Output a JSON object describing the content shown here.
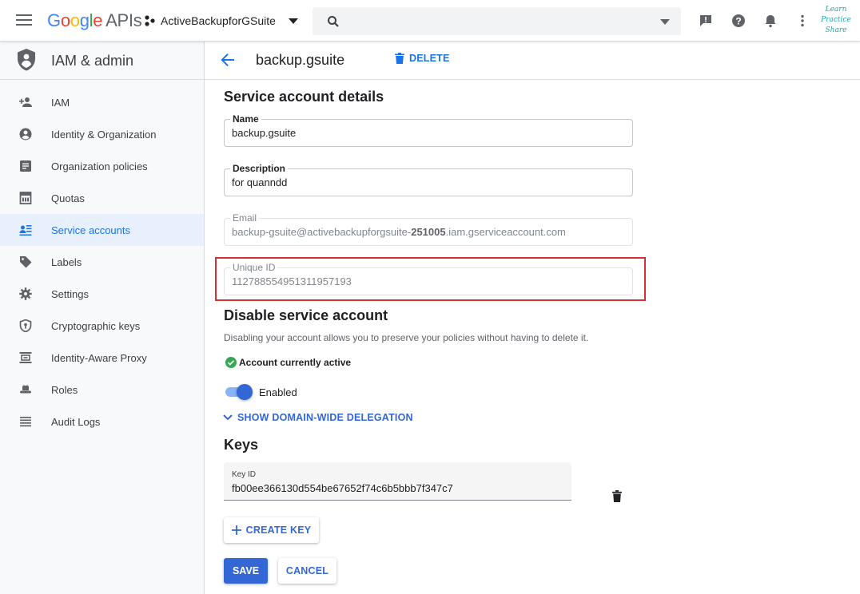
{
  "topbar": {
    "logo_parts": [
      "G",
      "o",
      "o",
      "g",
      "l",
      "e"
    ],
    "logo_suffix": "APIs",
    "project_name": "ActiveBackupforGSuite",
    "brand_stamp": [
      "Learn",
      "Practice",
      "Share"
    ]
  },
  "sidebar": {
    "title": "IAM & admin",
    "items": [
      {
        "label": "IAM",
        "icon": "person-add-icon"
      },
      {
        "label": "Identity & Organization",
        "icon": "account-circle-icon"
      },
      {
        "label": "Organization policies",
        "icon": "article-icon"
      },
      {
        "label": "Quotas",
        "icon": "calendar-grid-icon"
      },
      {
        "label": "Service accounts",
        "icon": "service-account-icon",
        "active": true
      },
      {
        "label": "Labels",
        "icon": "label-tag-icon"
      },
      {
        "label": "Settings",
        "icon": "gear-icon"
      },
      {
        "label": "Cryptographic keys",
        "icon": "shield-key-icon"
      },
      {
        "label": "Identity-Aware Proxy",
        "icon": "proxy-icon"
      },
      {
        "label": "Roles",
        "icon": "hat-icon"
      },
      {
        "label": "Audit Logs",
        "icon": "list-lines-icon"
      }
    ]
  },
  "header": {
    "title": "backup.gsuite",
    "delete_label": "DELETE"
  },
  "details": {
    "section_title": "Service account details",
    "name_label": "Name",
    "name_value": "backup.gsuite",
    "description_label": "Description",
    "description_value": "for quanndd",
    "email_label": "Email",
    "email_prefix": "backup-gsuite@activebackupforgsuite-",
    "email_bold": "251005",
    "email_suffix": ".iam.gserviceaccount.com",
    "unique_id_label": "Unique ID",
    "unique_id_value": "112788554951311957193"
  },
  "disable": {
    "section_title": "Disable service account",
    "description": "Disabling your account allows you to preserve your policies without having to delete it.",
    "status_text": "Account currently active",
    "toggle_label": "Enabled",
    "toggle_on": true,
    "delegation_label": "SHOW DOMAIN-WIDE DELEGATION"
  },
  "keys": {
    "section_title": "Keys",
    "key_id_label": "Key ID",
    "key_id_value": "fb00ee366130d554be67652f74c6b5bbb7f347c7",
    "create_key_label": "CREATE KEY"
  },
  "actions": {
    "save_label": "SAVE",
    "cancel_label": "CANCEL"
  },
  "colors": {
    "accent": "#1a73e8",
    "primary_button": "#3367d6",
    "highlight": "#d0323a",
    "success": "#34a853"
  }
}
